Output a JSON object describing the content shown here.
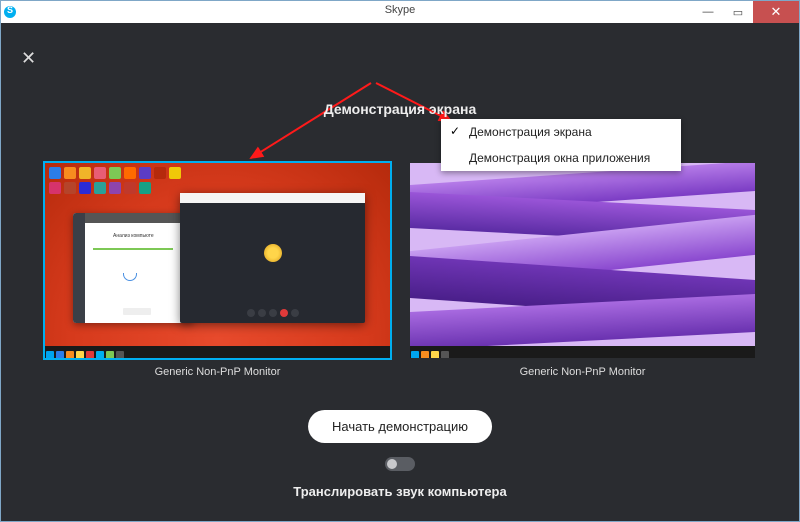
{
  "window": {
    "title": "Skype"
  },
  "heading": "Демонстрация экрана",
  "dropdown": {
    "item1": "Демонстрация экрана",
    "item2": "Демонстрация окна приложения"
  },
  "monitors": {
    "label1": "Generic Non-PnP Monitor",
    "label2": "Generic Non-PnP Monitor"
  },
  "ccleaner": {
    "title": "Анализ компьюте"
  },
  "start_button": "Начать демонстрацию",
  "audio_label": "Транслировать звук компьютера",
  "colors": {
    "accent": "#00aff0",
    "danger": "#c75050",
    "bg": "#2a2c30"
  }
}
